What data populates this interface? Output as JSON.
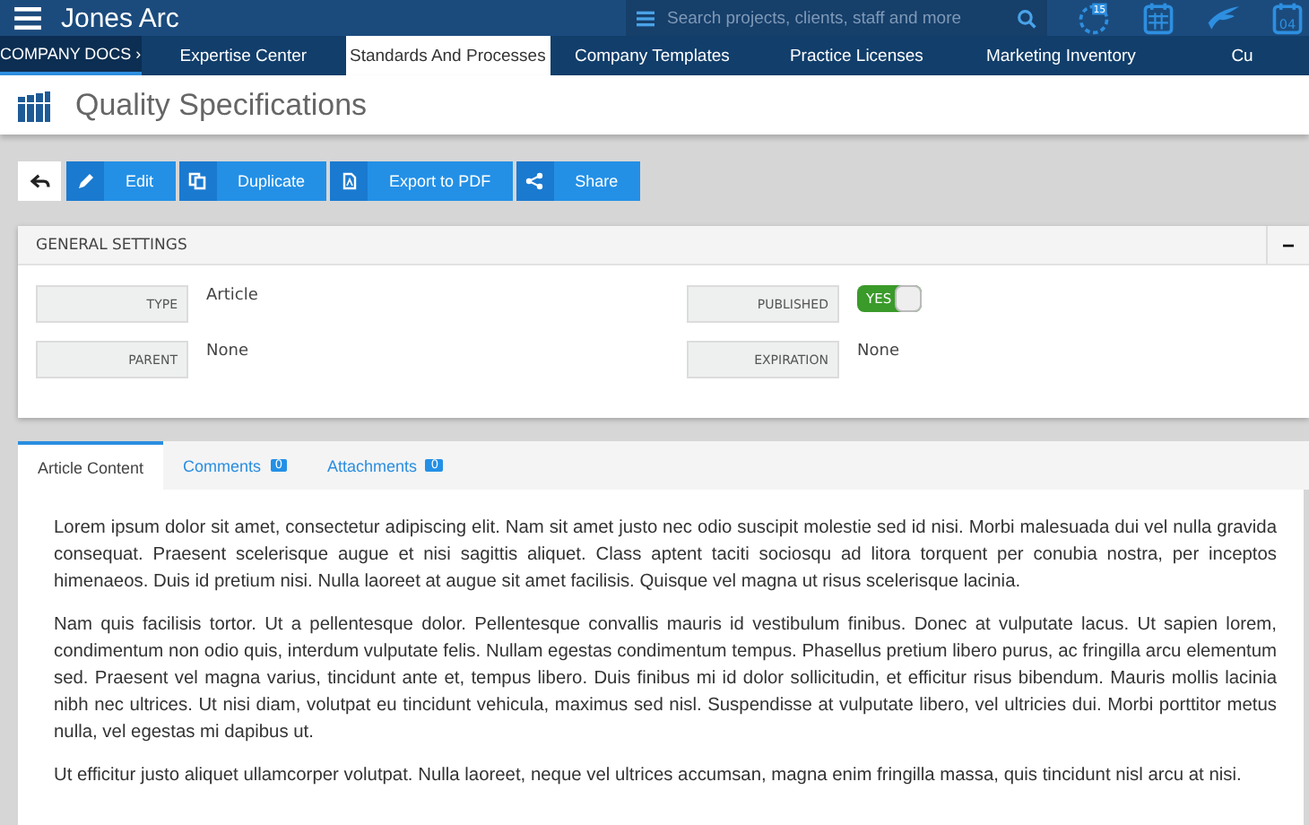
{
  "app": {
    "title": "Jones Arc",
    "search": {
      "placeholder": "Search projects, clients, staff and more"
    },
    "header_icons": [
      {
        "kind": "clock",
        "badge": "15"
      },
      {
        "kind": "calendar"
      },
      {
        "kind": "bird"
      },
      {
        "kind": "date",
        "badge": "04"
      }
    ]
  },
  "nav": {
    "section": "COMPANY DOCS",
    "section_icon": "›",
    "items": [
      {
        "label": "Expertise Center",
        "selected": false
      },
      {
        "label": "Standards And Processes",
        "selected": true
      },
      {
        "label": "Company Templates",
        "selected": false
      },
      {
        "label": "Practice Licenses",
        "selected": false
      },
      {
        "label": "Marketing Inventory",
        "selected": false
      },
      {
        "label": "Cu",
        "selected": false
      }
    ]
  },
  "page": {
    "title": "Quality Specifications"
  },
  "toolbar": [
    {
      "kind": "back"
    },
    {
      "kind": "edit",
      "label": "Edit"
    },
    {
      "kind": "duplicate",
      "label": "Duplicate"
    },
    {
      "kind": "pdf",
      "label": "Export to PDF"
    },
    {
      "kind": "share",
      "label": "Share"
    }
  ],
  "general_settings": {
    "title": "GENERAL SETTINGS",
    "collapse": "−",
    "fields": [
      {
        "label": "TYPE",
        "kind": "text",
        "value": "Article"
      },
      {
        "label": "PUBLISHED",
        "kind": "toggle",
        "on": true,
        "toggle_label": "YES"
      },
      {
        "label": "PARENT",
        "kind": "text",
        "value": "None"
      },
      {
        "label": "EXPIRATION",
        "kind": "text",
        "value": "None"
      }
    ]
  },
  "content_tabs": [
    {
      "label": "Article Content",
      "selected": true
    },
    {
      "label": "Comments",
      "count": "0",
      "selected": false
    },
    {
      "label": "Attachments",
      "count": "0",
      "selected": false
    }
  ],
  "article": [
    "Lorem ipsum dolor sit amet, consectetur adipiscing elit. Nam sit amet justo nec odio suscipit molestie sed id nisi. Morbi malesuada dui vel nulla gravida consequat. Praesent scelerisque augue et nisi sagittis aliquet. Class aptent taciti sociosqu ad litora torquent per conubia nostra, per inceptos himenaeos. Duis id pretium nisi. Nulla laoreet at augue sit amet facilisis. Quisque vel magna ut risus scelerisque lacinia.",
    "Nam quis facilisis tortor. Ut a pellentesque dolor. Pellentesque convallis mauris id vestibulum finibus. Donec at vulputate lacus. Ut sapien lorem, condimentum non odio quis, interdum vulputate felis. Nullam egestas condimentum tempus. Phasellus pretium libero purus, ac fringilla arcu elementum sed. Praesent vel magna varius, tincidunt ante et, tempus libero. Duis finibus mi id dolor sollicitudin, et efficitur risus bibendum. Mauris mollis lacinia nibh nec ultrices. Ut nisi diam, volutpat eu tincidunt vehicula, maximus sed nisl. Suspendisse at vulputate libero, vel ultricies dui. Morbi porttitor metus nulla, vel egestas mi dapibus ut.",
    "Ut efficitur justo aliquet ullamcorper volutpat. Nulla laoreet, neque vel ultrices accumsan, magna enim fringilla massa, quis tincidunt nisl arcu at nisi."
  ]
}
